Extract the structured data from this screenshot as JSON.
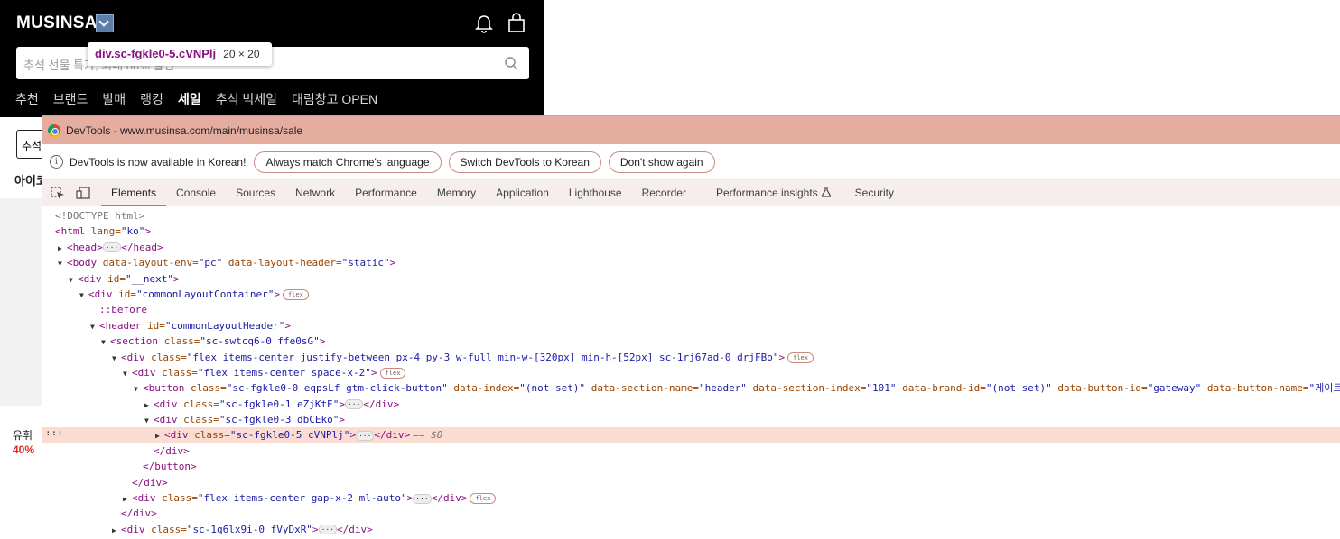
{
  "site": {
    "logo": "MUSINSA",
    "search_placeholder": "추석 선물 특가, 최대 80% 할인",
    "inspect_tooltip": {
      "selector": "div.sc-fgkle0-5.cVNPlj",
      "size": "20 × 20"
    },
    "nav": [
      "추천",
      "브랜드",
      "발매",
      "랭킹",
      "세일",
      "추석 빅세일",
      "대림창고 OPEN"
    ],
    "nav_active": "세일",
    "chip_label": "추석",
    "section_label": "아이코",
    "product_name": "유휘",
    "product_discount": "40%"
  },
  "devtools": {
    "title": "DevTools - www.musinsa.com/main/musinsa/sale",
    "info_text": "DevTools is now available in Korean!",
    "info_buttons": [
      "Always match Chrome's language",
      "Switch DevTools to Korean",
      "Don't show again"
    ],
    "tabs": [
      "Elements",
      "Console",
      "Sources",
      "Network",
      "Performance",
      "Memory",
      "Application",
      "Lighthouse",
      "Recorder",
      "Performance insights",
      "Security"
    ],
    "active_tab": "Elements",
    "tree": {
      "doctype": "<!DOCTYPE html>",
      "html_open": "<html",
      "html_lang_attr": " lang=",
      "html_lang_val": "\"ko\"",
      "head": "<head>",
      "head_close": "</head>",
      "body_open": "<body",
      "body_attr1": " data-layout-env=",
      "body_val1": "\"pc\"",
      "body_attr2": " data-layout-header=",
      "body_val2": "\"static\"",
      "next_open": "<div",
      "next_attr": " id=",
      "next_val": "\"__next\"",
      "container_open": "<div",
      "container_attr": " id=",
      "container_val": "\"commonLayoutContainer\"",
      "before": "::before",
      "header_open": "<header",
      "header_attr": " id=",
      "header_val": "\"commonLayoutHeader\"",
      "section_open": "<section",
      "section_attr": " class=",
      "section_val": "\"sc-swtcq6-0 ffe0sG\"",
      "flex_open": "<div",
      "flex_attr": " class=",
      "flex_val": "\"flex items-center justify-between px-4 py-3 w-full min-w-[320px] min-h-[52px] sc-1rj67ad-0 drjFBo\"",
      "space_open": "<div",
      "space_attr": " class=",
      "space_val": "\"flex items-center space-x-2\"",
      "button_open": "<button",
      "button_a1": " class=",
      "button_v1": "\"sc-fgkle0-0 eqpsLf gtm-click-button\"",
      "button_a2": " data-index=",
      "button_v2": "\"(not set)\"",
      "button_a3": " data-section-name=",
      "button_v3": "\"header\"",
      "button_a4": " data-section-index=",
      "button_v4": "\"101\"",
      "button_a5": " data-brand-id=",
      "button_v5": "\"(not set)\"",
      "button_a6": " data-button-id=",
      "button_v6": "\"gateway\"",
      "button_a7": " data-button-name=",
      "button_v7": "\"게이트웨이\"",
      "d1_open": "<div",
      "d1_attr": " class=",
      "d1_val": "\"sc-fgkle0-1 eZjKtE\"",
      "d3_open": "<div",
      "d3_attr": " class=",
      "d3_val": "\"sc-fgkle0-3 dbCEko\"",
      "d5_open": "<div",
      "d5_attr": " class=",
      "d5_val": "\"sc-fgkle0-5 cVNPlj\"",
      "div_close": "</div>",
      "eq": "== $0",
      "button_close": "</button>",
      "gap_open": "<div",
      "gap_attr": " class=",
      "gap_val": "\"flex items-center gap-x-2 ml-auto\"",
      "last_open": "<div",
      "last_attr": " class=",
      "last_val": "\"sc-1q6lx9i-0 fVyDxR\"",
      "flex_badge": "flex",
      "gt": ">",
      "left_dots": "···"
    }
  }
}
